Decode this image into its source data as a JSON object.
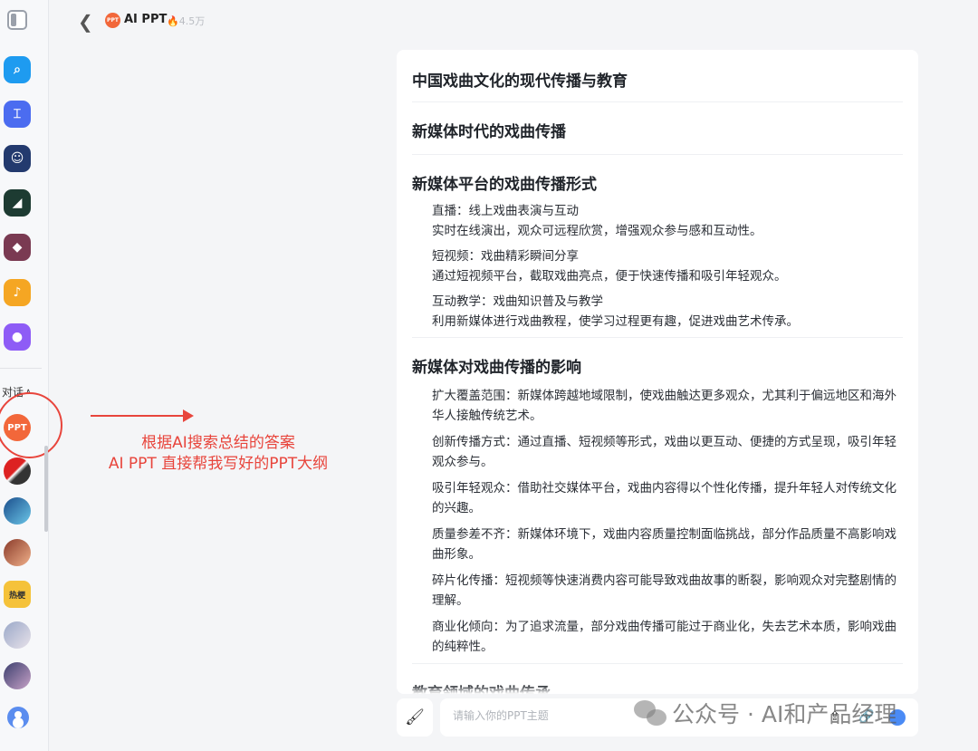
{
  "header": {
    "app_logo_text": "PPT",
    "app_name": "AI PPT",
    "hot_icon": "fire-icon",
    "hot_count": "4.5万"
  },
  "sidebar": {
    "section_label": "对话",
    "active_item_text": "PPT",
    "sticker_text": "热梗"
  },
  "annotation": {
    "line1": "根据AI搜索总结的答案",
    "line2": "AI PPT 直接帮我写好的PPT大纲",
    "color": "#e8453c"
  },
  "outline": {
    "title": "中国戏曲文化的现代传播与教育",
    "chapter1": "新媒体时代的戏曲传播",
    "section_forms": {
      "heading": "新媒体平台的戏曲传播形式",
      "items": [
        {
          "title": "直播：线上戏曲表演与互动",
          "desc": "实时在线演出，观众可远程欣赏，增强观众参与感和互动性。"
        },
        {
          "title": "短视频：戏曲精彩瞬间分享",
          "desc": "通过短视频平台，截取戏曲亮点，便于快速传播和吸引年轻观众。"
        },
        {
          "title": "互动教学：戏曲知识普及与教学",
          "desc": "利用新媒体进行戏曲教程，使学习过程更有趣，促进戏曲艺术传承。"
        }
      ]
    },
    "section_impact": {
      "heading": "新媒体对戏曲传播的影响",
      "items": [
        "扩大覆盖范围：新媒体跨越地域限制，使戏曲触达更多观众，尤其利于偏远地区和海外华人接触传统艺术。",
        "创新传播方式：通过直播、短视频等形式，戏曲以更互动、便捷的方式呈现，吸引年轻观众参与。",
        "吸引年轻观众：借助社交媒体平台，戏曲内容得以个性化传播，提升年轻人对传统文化的兴趣。",
        "质量参差不齐：新媒体环境下，戏曲内容质量控制面临挑战，部分作品质量不高影响戏曲形象。",
        "碎片化传播：短视频等快速消费内容可能导致戏曲故事的断裂，影响观众对完整剧情的理解。",
        "商业化倾向：为了追求流量，部分戏曲传播可能过于商业化，失去艺术本质，影响戏曲的纯粹性。"
      ]
    },
    "chapter2": "教育领域的戏曲传承"
  },
  "input": {
    "placeholder": "请输入你的PPT主题",
    "brush_icon": "brush-icon",
    "upload_icon": "file-upload-icon",
    "link_icon": "link-icon"
  },
  "watermark": {
    "text": "公众号 · AI和产品经理",
    "icon": "wechat-icon"
  }
}
